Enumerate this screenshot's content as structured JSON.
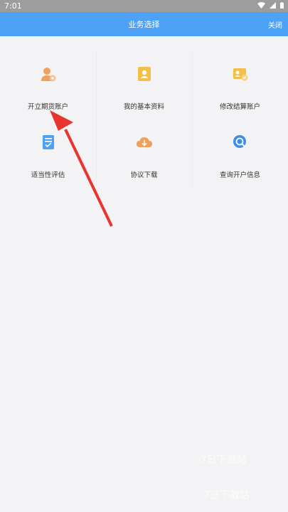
{
  "status": {
    "time": "7:01"
  },
  "appbar": {
    "title": "业务选择",
    "close": "关闭"
  },
  "items": [
    {
      "label": "开立期货账户",
      "icon": "user-add-icon",
      "color": "#f0a05a"
    },
    {
      "label": "我的基本资料",
      "icon": "id-card-icon",
      "color": "#f3be4a"
    },
    {
      "label": "修改结算账户",
      "icon": "account-edit-icon",
      "color": "#f3be4a"
    },
    {
      "label": "适当性评估",
      "icon": "clipboard-check-icon",
      "color": "#4ea2f5"
    },
    {
      "label": "协议下载",
      "icon": "cloud-download-icon",
      "color": "#f0a05a"
    },
    {
      "label": "查询开户信息",
      "icon": "search-info-icon",
      "color": "#3a8ee6"
    }
  ],
  "watermark": {
    "line1": "7日下载站",
    "line2": "7日下载站"
  }
}
